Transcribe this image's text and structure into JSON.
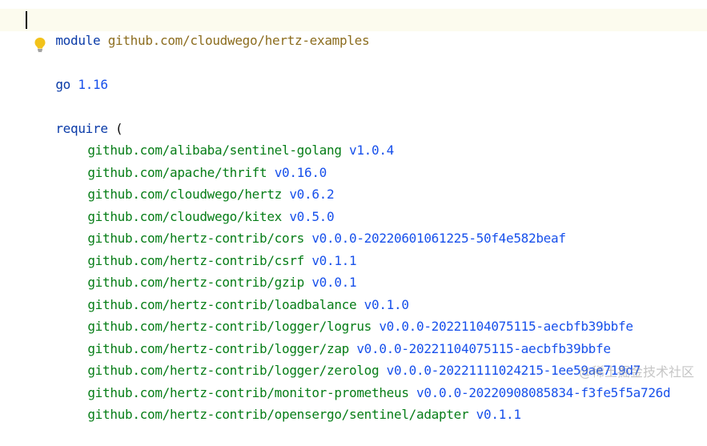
{
  "editor": {
    "module_keyword": "module",
    "module_path": "github.com/cloudwego/hertz-examples",
    "go_keyword": "go",
    "go_version": "1.16",
    "require_keyword": "require",
    "require_open": "(",
    "requires": [
      {
        "path": "github.com/alibaba/sentinel-golang",
        "version": "v1.0.4"
      },
      {
        "path": "github.com/apache/thrift",
        "version": "v0.16.0"
      },
      {
        "path": "github.com/cloudwego/hertz",
        "version": "v0.6.2"
      },
      {
        "path": "github.com/cloudwego/kitex",
        "version": "v0.5.0"
      },
      {
        "path": "github.com/hertz-contrib/cors",
        "version": "v0.0.0-20220601061225-50f4e582beaf"
      },
      {
        "path": "github.com/hertz-contrib/csrf",
        "version": "v0.1.1"
      },
      {
        "path": "github.com/hertz-contrib/gzip",
        "version": "v0.0.1"
      },
      {
        "path": "github.com/hertz-contrib/loadbalance",
        "version": "v0.1.0"
      },
      {
        "path": "github.com/hertz-contrib/logger/logrus",
        "version": "v0.0.0-20221104075115-aecbfb39bbfe"
      },
      {
        "path": "github.com/hertz-contrib/logger/zap",
        "version": "v0.0.0-20221104075115-aecbfb39bbfe"
      },
      {
        "path": "github.com/hertz-contrib/logger/zerolog",
        "version": "v0.0.0-20221111024215-1ee59ae719d7"
      },
      {
        "path": "github.com/hertz-contrib/monitor-prometheus",
        "version": "v0.0.0-20220908085834-f3fe5f5a726d"
      },
      {
        "path": "github.com/hertz-contrib/opensergo/sentinel/adapter",
        "version": "v0.1.1"
      }
    ]
  },
  "icons": {
    "lightbulb": "lightbulb-icon"
  },
  "watermark": {
    "text": "@稀土掘金技术社区"
  },
  "colors": {
    "keyword": "#0a3ba8",
    "module_path": "#8c6d1f",
    "dependency": "#067d17",
    "version": "#1750eb",
    "bulb": "#f2c21a",
    "current_line": "#fcfbee"
  }
}
